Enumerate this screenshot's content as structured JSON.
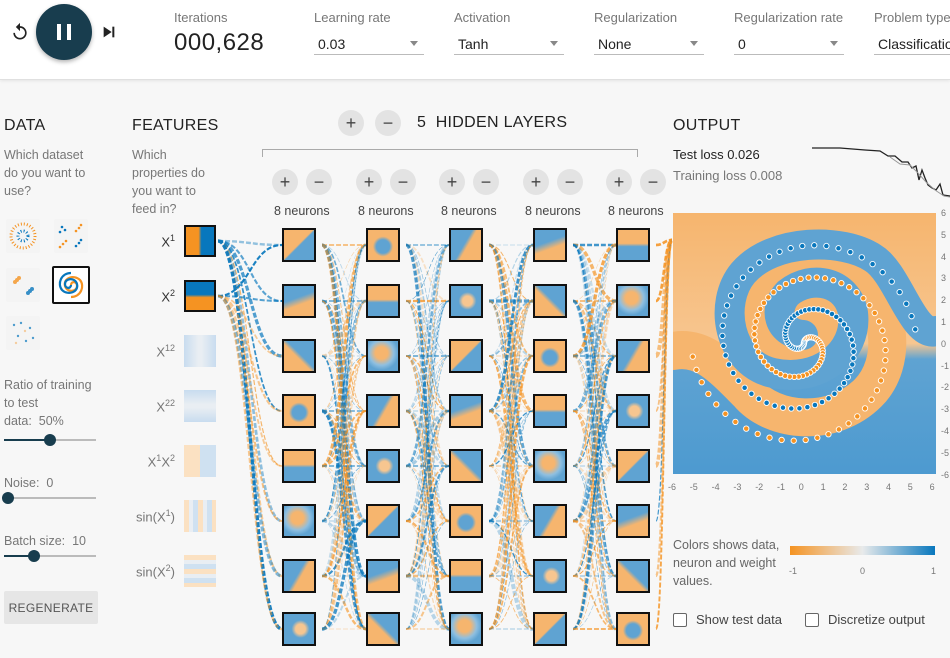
{
  "controls": {
    "reset_icon": "reset-icon",
    "play_icon": "pause-icon",
    "step_icon": "step-icon"
  },
  "iterations": {
    "label": "Iterations",
    "value": "000,628"
  },
  "fields": [
    {
      "label": "Learning rate",
      "value": "0.03"
    },
    {
      "label": "Activation",
      "value": "Tanh"
    },
    {
      "label": "Regularization",
      "value": "None"
    },
    {
      "label": "Regularization rate",
      "value": "0"
    },
    {
      "label": "Problem type",
      "value": "Classification"
    }
  ],
  "data_section": {
    "title": "DATA",
    "question": "Which dataset do you want to use?",
    "ratio_label": "Ratio of training to test data:",
    "ratio_value": "50%",
    "noise_label": "Noise:",
    "noise_value": "0",
    "batch_label": "Batch size:",
    "batch_value": "10",
    "regenerate": "REGENERATE"
  },
  "features_section": {
    "title": "FEATURES",
    "question": "Which properties do you want to feed in?",
    "features": [
      {
        "base": "X",
        "sup": "1",
        "sub": "",
        "active": true
      },
      {
        "base": "X",
        "sup": "2",
        "sub": "",
        "active": true
      },
      {
        "base": "X",
        "sup": "12",
        "sub": "",
        "active": false
      },
      {
        "base": "X",
        "sup": "22",
        "sub": "",
        "active": false
      },
      {
        "base": "X",
        "sup": "1",
        "sub": "X",
        "sup2": "2",
        "active": false
      },
      {
        "base": "sin(X",
        "sup": "1",
        "tail": ")",
        "active": false
      },
      {
        "base": "sin(X",
        "sup": "2",
        "tail": ")",
        "active": false
      }
    ]
  },
  "hidden": {
    "count": "5",
    "title": "HIDDEN LAYERS",
    "add_symbol": "+",
    "remove_symbol": "−",
    "neuron_labels": [
      "8 neurons",
      "8 neurons",
      "8 neurons",
      "8 neurons",
      "8 neurons"
    ]
  },
  "output": {
    "title": "OUTPUT",
    "test_loss_label": "Test loss",
    "test_loss": "0.026",
    "training_loss_label": "Training loss",
    "training_loss": "0.008",
    "x_ticks": [
      "-6",
      "-5",
      "-4",
      "-3",
      "-2",
      "-1",
      "0",
      "1",
      "2",
      "3",
      "4",
      "5",
      "6"
    ],
    "y_ticks": [
      "6",
      "5",
      "4",
      "3",
      "2",
      "1",
      "0",
      "-1",
      "-2",
      "-3",
      "-4",
      "-5",
      "-6"
    ],
    "legend_text": "Colors shows data, neuron and weight values.",
    "legend_ticks": [
      "-1",
      "0",
      "1"
    ],
    "show_test_data": "Show test data",
    "discretize": "Discretize output"
  },
  "colors": {
    "orange": "#f59322",
    "blue": "#0877bd",
    "dark": "#183d4e",
    "neutral": "#e8eaeb"
  }
}
